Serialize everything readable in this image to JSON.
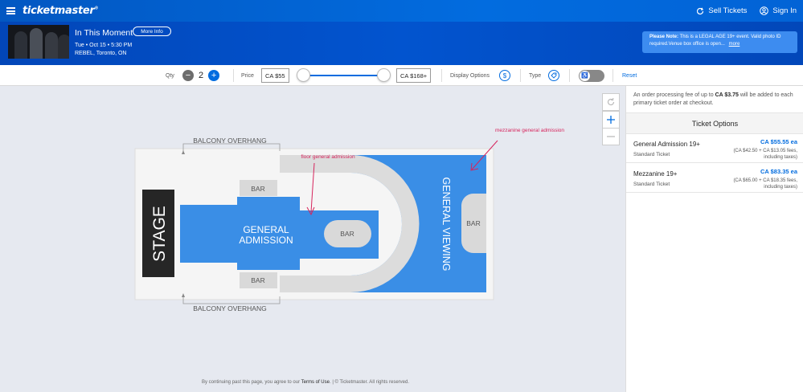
{
  "nav": {
    "logo": "ticketmaster",
    "logo_mark": "®",
    "sell_tickets": "Sell Tickets",
    "sign_in": "Sign In"
  },
  "event": {
    "title": "In This Moment",
    "more_info": "More Info",
    "date": "Tue • Oct 15 • 5:30 PM",
    "venue": "REBEL, Toronto, ON",
    "note_label": "Please Note:",
    "note_text": "This is a LEGAL AGE 19+ event. Valid photo ID required.Venue box office is open...",
    "note_more": "more"
  },
  "filters": {
    "qty_label": "Qty",
    "qty_value": "2",
    "price_label": "Price",
    "price_min": "CA $55",
    "price_max": "CA $168+",
    "display_options": "Display Options",
    "display_icon_glyph": "$",
    "type_label": "Type",
    "reset": "Reset"
  },
  "map": {
    "balcony_top": "BALCONY OVERHANG",
    "balcony_bottom": "BALCONY OVERHANG",
    "stage": "STAGE",
    "ga_line1": "GENERAL",
    "ga_line2": "ADMISSION",
    "bar": "BAR",
    "general_viewing": "GENERAL VIEWING",
    "annotation_floor": "floor general admission",
    "annotation_mezz": "mezzanine general admission",
    "colors": {
      "section_blue": "#3a8ee6",
      "walkway_gray": "#dcdcdc",
      "bar_gray": "#d9d9d9",
      "stage_black": "#262626",
      "annotation_pink": "#d6245c"
    }
  },
  "footer": {
    "prefix": "By continuing past this page, you agree to our ",
    "terms": "Terms of Use",
    "suffix": ". | © Ticketmaster. All rights reserved."
  },
  "panel": {
    "fee_prefix": "An order processing fee of up to ",
    "fee_amount": "CA $3.75",
    "fee_suffix": " will be added to each primary ticket order at checkout.",
    "heading": "Ticket Options",
    "tickets": [
      {
        "name": "General Admission 19+",
        "type": "Standard Ticket",
        "price": "CA $55.55 ea",
        "fees_line1": "(CA $42.50 + CA $13.05 fees,",
        "fees_line2": "including taxes)"
      },
      {
        "name": "Mezzanine 19+",
        "type": "Standard Ticket",
        "price": "CA $83.35 ea",
        "fees_line1": "(CA $65.00 + CA $18.35 fees,",
        "fees_line2": "including taxes)"
      }
    ]
  },
  "icons": {
    "menu": "hamburger-icon",
    "sell": "refresh-cycle-icon",
    "user": "user-icon",
    "wheelchair": "wheelchair-icon",
    "tag": "tag-icon"
  },
  "theme": {
    "brand_blue": "#026cdf",
    "header_blue": "#0250d0"
  }
}
